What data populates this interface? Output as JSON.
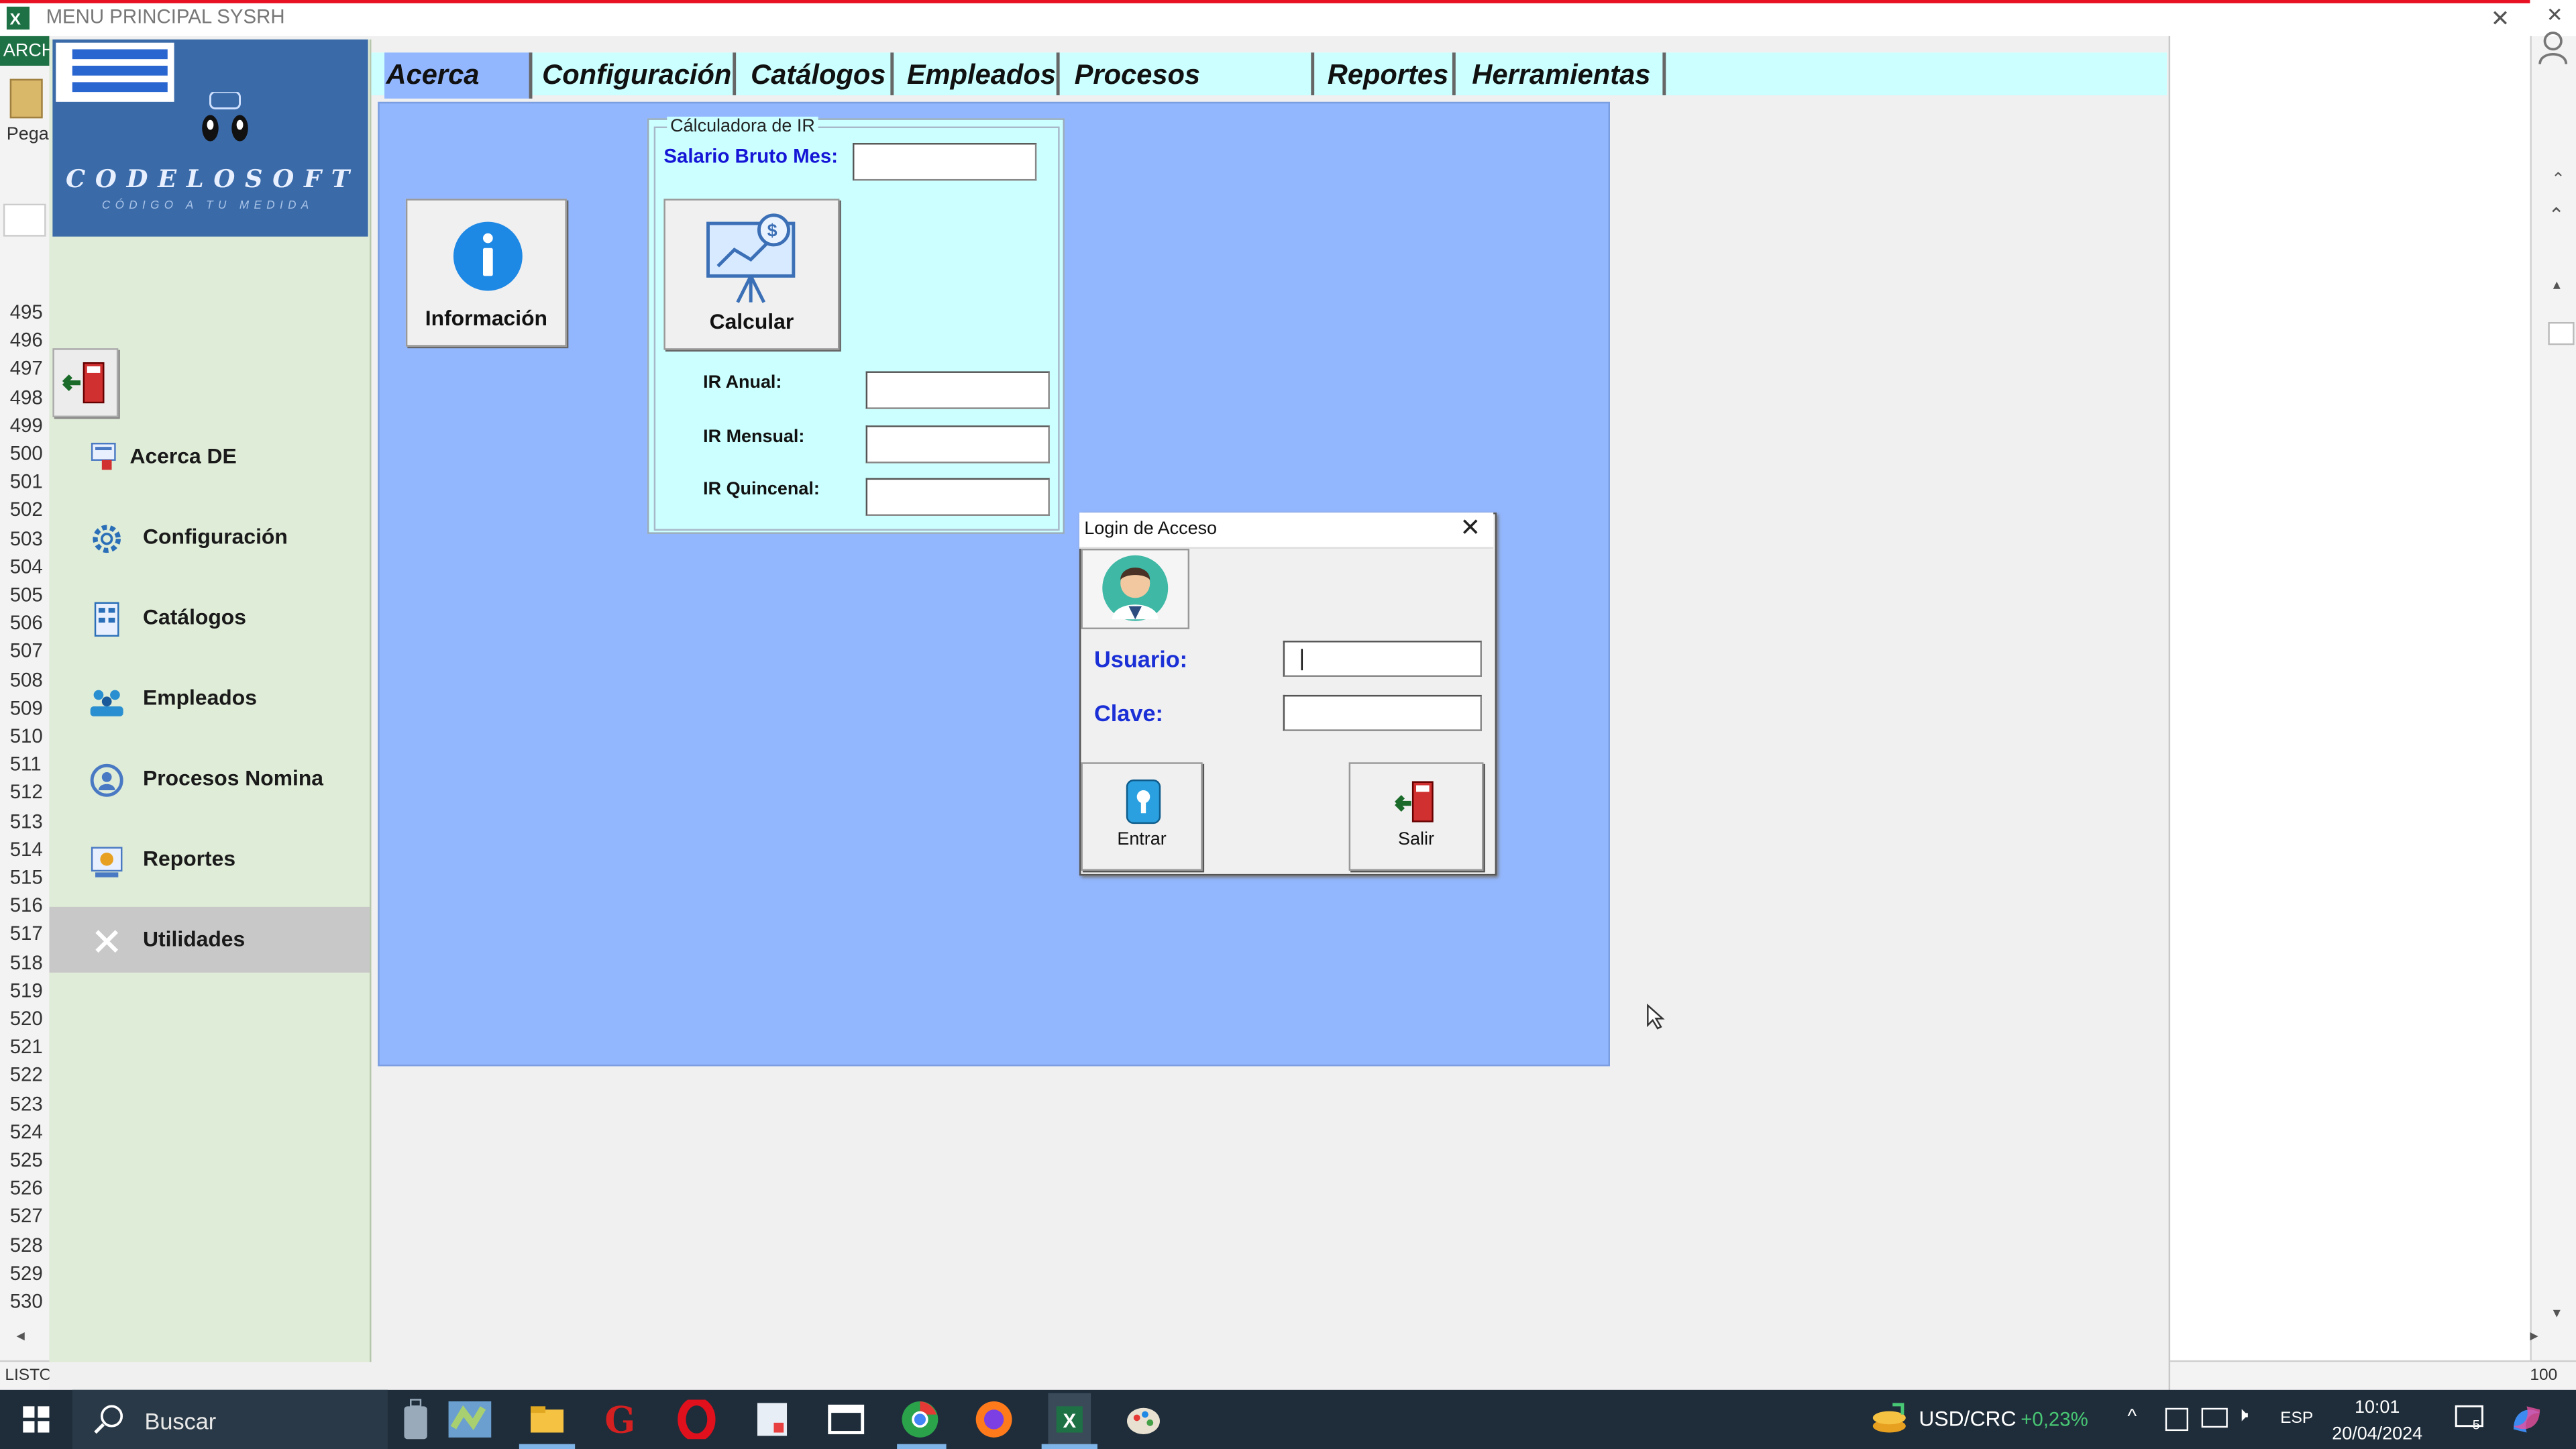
{
  "window": {
    "title": "MENU PRINCIPAL SYSRH"
  },
  "excel": {
    "ribbon_tab": "ARCH",
    "paste_label": "Pega",
    "row_numbers": [
      "495",
      "496",
      "497",
      "498",
      "499",
      "500",
      "501",
      "502",
      "503",
      "504",
      "505",
      "506",
      "507",
      "508",
      "509",
      "510",
      "511",
      "512",
      "513",
      "514",
      "515",
      "516",
      "517",
      "518",
      "519",
      "520",
      "521",
      "522",
      "523",
      "524",
      "525",
      "526",
      "527",
      "528",
      "529",
      "530"
    ],
    "status_left": "LISTO",
    "zoom": "100 %"
  },
  "logo": {
    "text": "CODELOSOFT",
    "tagline": "CÓDIGO A TU MEDIDA"
  },
  "sidebar": {
    "items": [
      {
        "label": "Acerca DE",
        "icon": "info-card-icon"
      },
      {
        "label": "Configuración",
        "icon": "gear-icon"
      },
      {
        "label": "Catálogos",
        "icon": "catalog-icon"
      },
      {
        "label": "Empleados",
        "icon": "employees-icon"
      },
      {
        "label": "Procesos Nomina",
        "icon": "payroll-process-icon"
      },
      {
        "label": "Reportes",
        "icon": "reports-icon"
      },
      {
        "label": "Utilidades",
        "icon": "tools-icon"
      }
    ],
    "active": "Utilidades"
  },
  "tabs": [
    "Acerca DE",
    "Configuración",
    "Catálogos",
    "Empleados",
    "Procesos Nómina",
    "Reportes",
    "Herramientas"
  ],
  "info_button": {
    "label": "Información"
  },
  "calculator": {
    "title": "Cálculadora de IR",
    "salario_label": "Salario Bruto Mes:",
    "salario_value": "",
    "calc_button": "Calcular",
    "ir_anual_label": "IR Anual:",
    "ir_mensual_label": "IR Mensual:",
    "ir_quincenal_label": "IR Quincenal:",
    "ir_anual_value": "",
    "ir_mensual_value": "",
    "ir_quincenal_value": ""
  },
  "login": {
    "title": "Login de Acceso",
    "usuario_label": "Usuario:",
    "clave_label": "Clave:",
    "usuario_value": "",
    "clave_value": "",
    "enter_button": "Entrar",
    "exit_button": "Salir"
  },
  "taskbar": {
    "search_placeholder": "Buscar",
    "ticker_symbol": "USD/CRC",
    "ticker_change": "+0,23%",
    "language": "ESP",
    "time": "10:01",
    "date": "20/04/2024",
    "notifications": "5"
  },
  "colors": {
    "content_bg": "#93b7fe",
    "tabstrip_bg": "#ccffff",
    "sidebar_bg": "#dfecd7",
    "label_blue": "#1a2fd6"
  }
}
